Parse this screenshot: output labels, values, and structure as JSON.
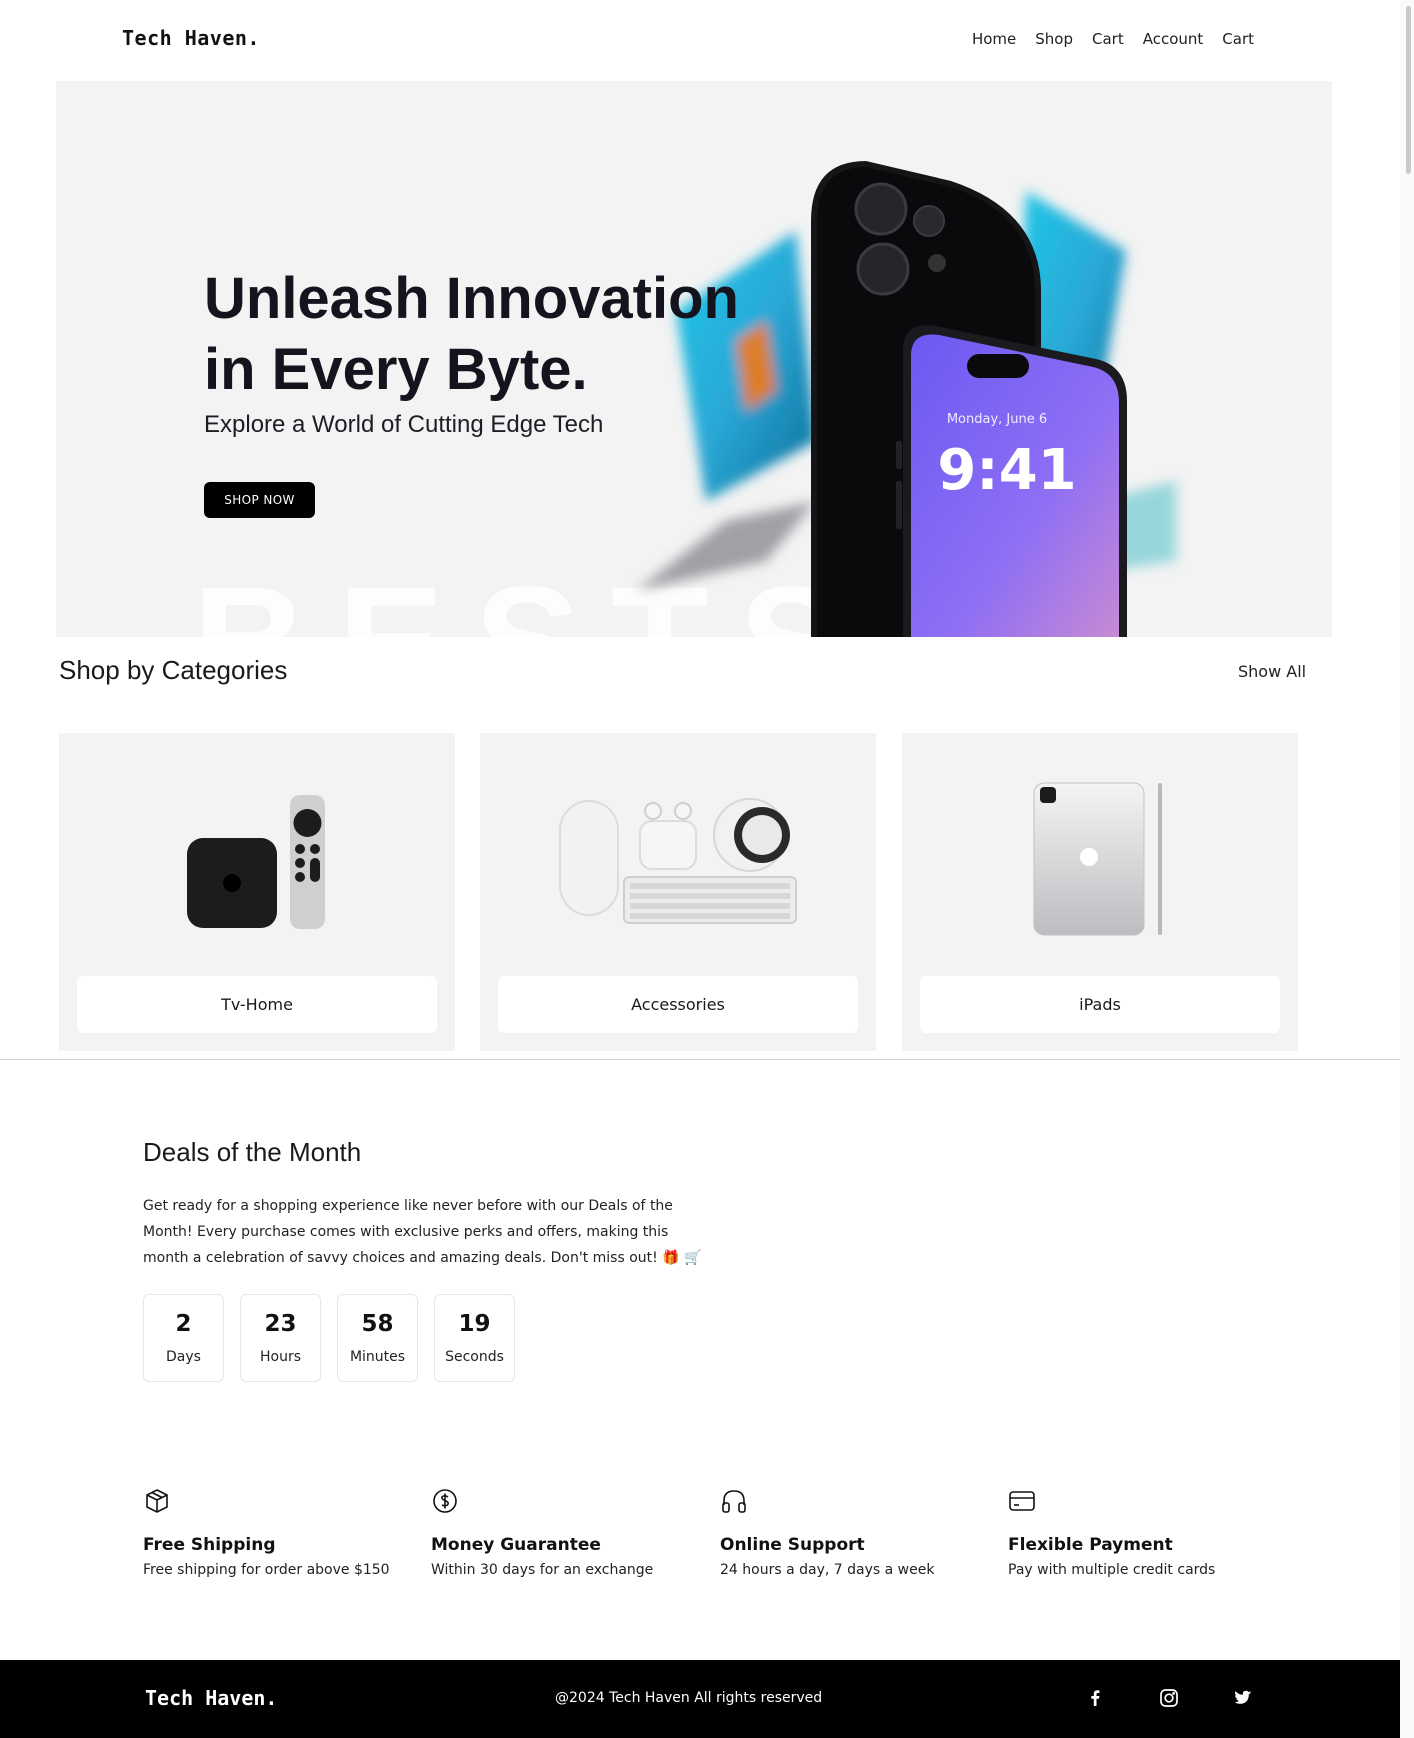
{
  "header": {
    "logo": "Tech Haven.",
    "nav": [
      "Home",
      "Shop",
      "Cart",
      "Account",
      "Cart"
    ]
  },
  "hero": {
    "title_line1": "Unleash Innovation",
    "title_line2": "in Every Byte.",
    "subtitle": "Explore a World of Cutting Edge Tech",
    "cta": "SHOP NOW",
    "background_text": "BESTS    E",
    "phone_date": "Monday, June 6",
    "phone_time": "9:41"
  },
  "categories": {
    "title": "Shop by Categories",
    "show_all": "Show All",
    "items": [
      {
        "label": "Tv-Home",
        "icon": "apple-tv-icon"
      },
      {
        "label": "Accessories",
        "icon": "accessories-icon"
      },
      {
        "label": "iPads",
        "icon": "ipad-icon"
      }
    ]
  },
  "deals": {
    "title": "Deals of the Month",
    "text": "Get ready for a shopping experience like never before with our Deals of the Month! Every purchase comes with exclusive perks and offers, making this month a celebration of savvy choices and amazing deals. Don't miss out! 🎁 🛒",
    "countdown": [
      {
        "value": "2",
        "label": "Days"
      },
      {
        "value": "23",
        "label": "Hours"
      },
      {
        "value": "58",
        "label": "Minutes"
      },
      {
        "value": "19",
        "label": "Seconds"
      }
    ]
  },
  "features": [
    {
      "icon": "box-icon",
      "title": "Free Shipping",
      "desc": "Free shipping for order above $150"
    },
    {
      "icon": "dollar-icon",
      "title": "Money Guarantee",
      "desc": "Within 30 days for an exchange"
    },
    {
      "icon": "headphones-icon",
      "title": "Online Support",
      "desc": "24 hours a day, 7 days a week"
    },
    {
      "icon": "credit-card-icon",
      "title": "Flexible Payment",
      "desc": "Pay with multiple credit cards"
    }
  ],
  "footer": {
    "logo": "Tech Haven.",
    "copyright": "@2024 Tech Haven All rights reserved",
    "social": [
      "facebook-icon",
      "instagram-icon",
      "twitter-icon"
    ]
  },
  "colors": {
    "background": "#ffffff",
    "hero_bg": "#f3f3f3",
    "footer_bg": "#000000",
    "button": "#000000",
    "phone_screen": "#7a5cf0"
  }
}
